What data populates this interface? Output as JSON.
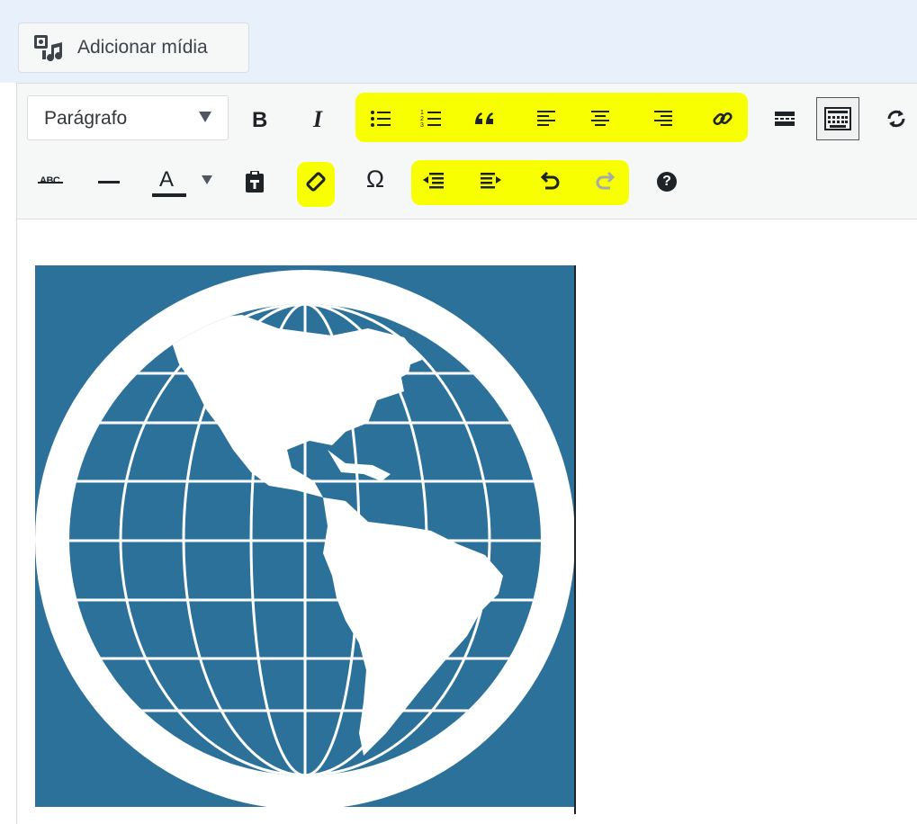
{
  "media_button": {
    "label": "Adicionar mídia",
    "icon": "media-icon"
  },
  "toolbar": {
    "format_select": {
      "selected": "Parágrafo"
    },
    "row1": [
      {
        "name": "bold-icon",
        "title": "Negrito"
      },
      {
        "name": "italic-icon",
        "title": "Itálico"
      },
      {
        "name": "bullet-list-icon",
        "title": "Lista não ordenada"
      },
      {
        "name": "numbered-list-icon",
        "title": "Lista ordenada"
      },
      {
        "name": "blockquote-icon",
        "title": "Citação"
      },
      {
        "name": "align-left-icon",
        "title": "Alinhar à esquerda"
      },
      {
        "name": "align-center-icon",
        "title": "Centralizar"
      },
      {
        "name": "align-right-icon",
        "title": "Alinhar à direita"
      },
      {
        "name": "link-icon",
        "title": "Inserir/editar link"
      },
      {
        "name": "read-more-icon",
        "title": "Inserir tag Leia mais"
      },
      {
        "name": "toolbar-toggle-icon",
        "title": "Alternar barra de ferramentas"
      },
      {
        "name": "refresh-icon",
        "title": ""
      }
    ],
    "row2": [
      {
        "name": "strikethrough-icon",
        "title": "Tachado"
      },
      {
        "name": "horizontal-line-icon",
        "title": "Linha horizontal"
      },
      {
        "name": "text-color-icon",
        "title": "Cor do texto"
      },
      {
        "name": "paste-as-text-icon",
        "title": "Colar como texto"
      },
      {
        "name": "clear-formatting-icon",
        "title": "Limpar formatação"
      },
      {
        "name": "special-character-icon",
        "title": "Caracteres especiais"
      },
      {
        "name": "outdent-icon",
        "title": "Diminuir recuo"
      },
      {
        "name": "indent-icon",
        "title": "Aumentar recuo"
      },
      {
        "name": "undo-icon",
        "title": "Desfazer"
      },
      {
        "name": "redo-icon",
        "title": "Refazer"
      },
      {
        "name": "help-icon",
        "title": "Atalhos do teclado"
      }
    ],
    "strike_glyph": "ABC",
    "text_color_glyph": "A",
    "omega_glyph": "Ω",
    "help_glyph": "?"
  },
  "colors": {
    "highlight": "#f8ff00",
    "icon": "#1d2327",
    "icon_disabled": "#a7aaad",
    "globe_bg": "#2b7199",
    "globe_fg": "#ffffff",
    "text_color_bar": "#1d2327"
  },
  "content": {
    "image": "globe-americas-image"
  }
}
